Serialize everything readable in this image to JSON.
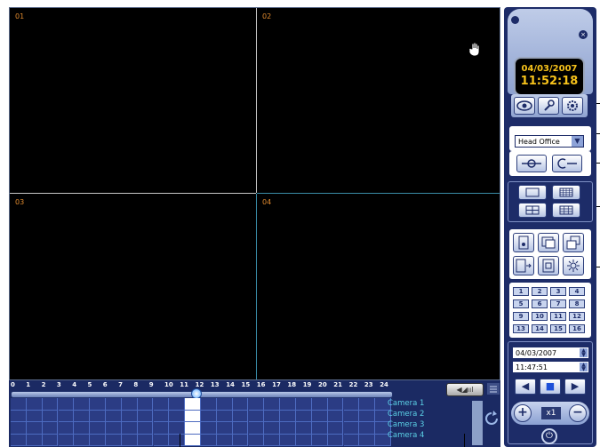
{
  "video": {
    "channels": [
      {
        "label": "01"
      },
      {
        "label": "02"
      },
      {
        "label": "03"
      },
      {
        "label": "04"
      }
    ]
  },
  "timeline": {
    "hours": [
      "0",
      "1",
      "2",
      "3",
      "4",
      "5",
      "6",
      "7",
      "8",
      "9",
      "10",
      "11",
      "12",
      "13",
      "14",
      "15",
      "16",
      "17",
      "18",
      "19",
      "20",
      "21",
      "22",
      "23",
      "24"
    ],
    "cameras": [
      "Camera 1",
      "Camera 2",
      "Camera 3",
      "Camera 4"
    ],
    "audio_label": "◀◢ııl"
  },
  "clock": {
    "date": "04/03/2007",
    "time": "11:52:18"
  },
  "site": {
    "selected": "Head Office"
  },
  "channel_buttons": [
    "1",
    "2",
    "3",
    "4",
    "5",
    "6",
    "7",
    "8",
    "9",
    "10",
    "11",
    "12",
    "13",
    "14",
    "15",
    "16"
  ],
  "playback": {
    "date": "04/03/2007",
    "time": "11:47:51",
    "speed": "x1"
  },
  "colors": {
    "panel": "#1d2c68",
    "channel_label": "#e08a2e",
    "clock_digits": "#f6c21b",
    "camera_text": "#5bd1e6"
  }
}
